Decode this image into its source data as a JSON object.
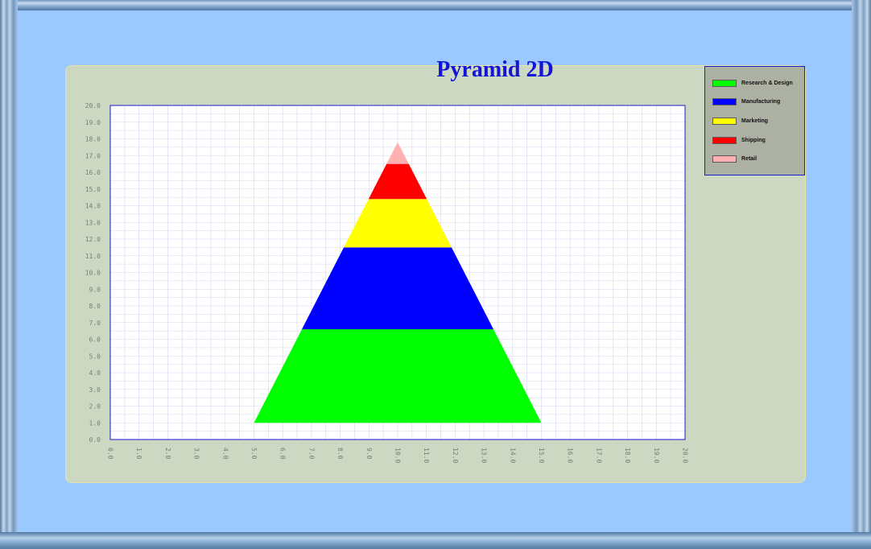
{
  "chart_data": {
    "type": "pyramid",
    "title": "Pyramid 2D",
    "xlim": [
      0,
      20
    ],
    "ylim": [
      0,
      20
    ],
    "grid": true,
    "legend_placement": "top-right",
    "x_ticks": [
      "0.0",
      "1.0",
      "2.0",
      "3.0",
      "4.0",
      "5.0",
      "6.0",
      "7.0",
      "8.0",
      "9.0",
      "10.0",
      "11.0",
      "12.0",
      "13.0",
      "14.0",
      "15.0",
      "16.0",
      "17.0",
      "18.0",
      "19.0",
      "20.0"
    ],
    "y_ticks": [
      "0.0",
      "1.0",
      "2.0",
      "3.0",
      "4.0",
      "5.0",
      "6.0",
      "7.0",
      "8.0",
      "9.0",
      "10.0",
      "11.0",
      "12.0",
      "13.0",
      "14.0",
      "15.0",
      "16.0",
      "17.0",
      "18.0",
      "19.0",
      "20.0"
    ],
    "apex": {
      "x": 10,
      "y": 17.8
    },
    "base": {
      "x_left": 5,
      "x_right": 15,
      "y": 1
    },
    "series": [
      {
        "name": "Research & Design",
        "color": "#00ff00",
        "y_from": 1.0,
        "y_to": 6.6
      },
      {
        "name": "Manufacturing",
        "color": "#0000ff",
        "y_from": 6.6,
        "y_to": 11.5
      },
      {
        "name": "Marketing",
        "color": "#ffff00",
        "y_from": 11.5,
        "y_to": 14.4
      },
      {
        "name": "Shipping",
        "color": "#ff0000",
        "y_from": 14.4,
        "y_to": 16.5
      },
      {
        "name": "Retail",
        "color": "#ffb0b0",
        "y_from": 16.5,
        "y_to": 17.8
      }
    ],
    "colors": {
      "plot_bg": "#ffffff",
      "grid": "#d4d8f2",
      "axis": "#1b1bd0"
    }
  }
}
